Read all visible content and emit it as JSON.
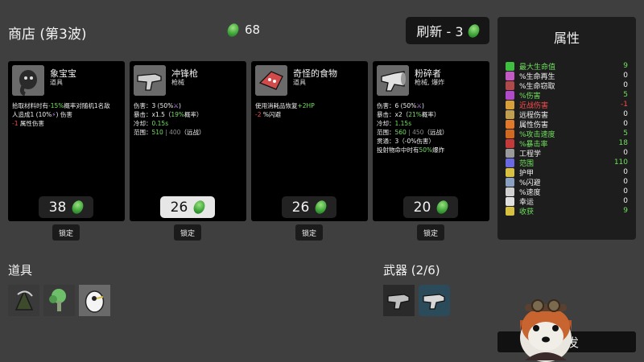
{
  "header": {
    "shop_title": "商店 (第3波)",
    "materials": "68",
    "reroll_label": "刷新 - 3"
  },
  "stats": {
    "title": "属性",
    "rows": [
      {
        "label": "最大生命值",
        "value": "9",
        "color": "#6fe05c",
        "icon": "heart-icon",
        "icon_color": "#3fbf3f"
      },
      {
        "label": "%生命再生",
        "value": "0",
        "color": "#f2f2f2",
        "icon": "regen-icon",
        "icon_color": "#c45ac4"
      },
      {
        "label": "%生命窃取",
        "value": "0",
        "color": "#f2f2f2",
        "icon": "lifesteal-icon",
        "icon_color": "#b04a4a"
      },
      {
        "label": "%伤害",
        "value": "5",
        "color": "#6fe05c",
        "icon": "damage-icon",
        "icon_color": "#b24acc"
      },
      {
        "label": "近战伤害",
        "value": "-1",
        "color": "#ff4b4b",
        "icon": "melee-icon",
        "icon_color": "#d8a03a"
      },
      {
        "label": "远程伤害",
        "value": "0",
        "color": "#f2f2f2",
        "icon": "ranged-icon",
        "icon_color": "#c0a050"
      },
      {
        "label": "属性伤害",
        "value": "0",
        "color": "#f2f2f2",
        "icon": "elemental-icon",
        "icon_color": "#e07a2a"
      },
      {
        "label": "%攻击速度",
        "value": "5",
        "color": "#6fe05c",
        "icon": "attack-speed-icon",
        "icon_color": "#d06a20"
      },
      {
        "label": "%暴击率",
        "value": "18",
        "color": "#6fe05c",
        "icon": "crit-icon",
        "icon_color": "#c43a3a"
      },
      {
        "label": "工程学",
        "value": "0",
        "color": "#f2f2f2",
        "icon": "engineering-icon",
        "icon_color": "#9a9a9a"
      },
      {
        "label": "范围",
        "value": "110",
        "color": "#6fe05c",
        "icon": "range-icon",
        "icon_color": "#6a6ae0"
      },
      {
        "label": "护甲",
        "value": "0",
        "color": "#f2f2f2",
        "icon": "armor-icon",
        "icon_color": "#d8c040"
      },
      {
        "label": "%闪避",
        "value": "0",
        "color": "#f2f2f2",
        "icon": "dodge-icon",
        "icon_color": "#8aa0c0"
      },
      {
        "label": "%速度",
        "value": "0",
        "color": "#f2f2f2",
        "icon": "speed-icon",
        "icon_color": "#d0d0d0"
      },
      {
        "label": "幸运",
        "value": "0",
        "color": "#f2f2f2",
        "icon": "luck-icon",
        "icon_color": "#e0e0e0"
      },
      {
        "label": "收获",
        "value": "9",
        "color": "#6fe05c",
        "icon": "harvest-icon",
        "icon_color": "#d8c040"
      }
    ]
  },
  "cards": [
    {
      "name": "象宝宝",
      "type": "道具",
      "icon": "elephant-icon",
      "price": "38",
      "lock_label": "锁定",
      "lines": [
        [
          {
            "t": "拾取材料时有",
            "c": ""
          },
          {
            "t": "-15%",
            "c": "g"
          },
          {
            "t": "概率对随机1名敌",
            "c": ""
          }
        ],
        [
          {
            "t": "人造成1 (10%",
            "c": ""
          },
          {
            "t": "⚡",
            "c": "p"
          },
          {
            "t": ") 伤害",
            "c": ""
          }
        ],
        [
          {
            "t": "-1",
            "c": "r"
          },
          {
            "t": " 属性伤害",
            "c": ""
          }
        ]
      ]
    },
    {
      "name": "冲锋枪",
      "type": "枪械",
      "icon": "smg-icon",
      "price": "26",
      "selected": true,
      "lock_label": "锁定",
      "lines": [
        [
          {
            "t": "伤害：3 (50%",
            "c": ""
          },
          {
            "t": "⚔",
            "c": "p"
          },
          {
            "t": ")",
            "c": ""
          }
        ],
        [
          {
            "t": "暴击：x1.5（",
            "c": ""
          },
          {
            "t": "19%",
            "c": "g"
          },
          {
            "t": "概率）",
            "c": ""
          }
        ],
        [
          {
            "t": "冷却：",
            "c": ""
          },
          {
            "t": "0.15s",
            "c": "g"
          }
        ],
        [
          {
            "t": "范围：",
            "c": ""
          },
          {
            "t": "510",
            "c": "g"
          },
          {
            "t": " | 400",
            "c": "gr"
          },
          {
            "t": "（远战）",
            "c": ""
          }
        ]
      ]
    },
    {
      "name": "奇怪的食物",
      "type": "道具",
      "icon": "strange-food-icon",
      "price": "26",
      "lock_label": "锁定",
      "lines": [
        [
          {
            "t": "使用消耗品恢复",
            "c": ""
          },
          {
            "t": "+2HP",
            "c": "g"
          }
        ],
        [
          {
            "t": "-2",
            "c": "r"
          },
          {
            "t": " %闪避",
            "c": ""
          }
        ]
      ]
    },
    {
      "name": "粉碎者",
      "type": "枪械, 爆炸",
      "icon": "pulverizer-icon",
      "price": "20",
      "lock_label": "锁定",
      "lines": [
        [
          {
            "t": "伤害：6 (50%",
            "c": ""
          },
          {
            "t": "⚔",
            "c": "p"
          },
          {
            "t": ")",
            "c": ""
          }
        ],
        [
          {
            "t": "暴击：x2（",
            "c": ""
          },
          {
            "t": "21%",
            "c": "g"
          },
          {
            "t": "概率）",
            "c": ""
          }
        ],
        [
          {
            "t": "冷却：",
            "c": ""
          },
          {
            "t": "1.15s",
            "c": "g"
          }
        ],
        [
          {
            "t": "范围：",
            "c": ""
          },
          {
            "t": "560",
            "c": "g"
          },
          {
            "t": " | 450",
            "c": "gr"
          },
          {
            "t": "（远战）",
            "c": ""
          }
        ],
        [
          {
            "t": "贯通：3（-0%伤害）",
            "c": ""
          }
        ],
        [
          {
            "t": "投射物命中时有",
            "c": ""
          },
          {
            "t": "50%",
            "c": "g"
          },
          {
            "t": "爆炸",
            "c": ""
          }
        ]
      ]
    }
  ],
  "items_section": {
    "label": "道具",
    "items": [
      "scythe-hat-icon",
      "alien-tree-icon",
      "egg-eye-icon"
    ]
  },
  "weapons_section": {
    "label": "武器 (2/6)",
    "items": [
      "smg-icon",
      "smg-icon"
    ]
  },
  "start_label": "出发"
}
